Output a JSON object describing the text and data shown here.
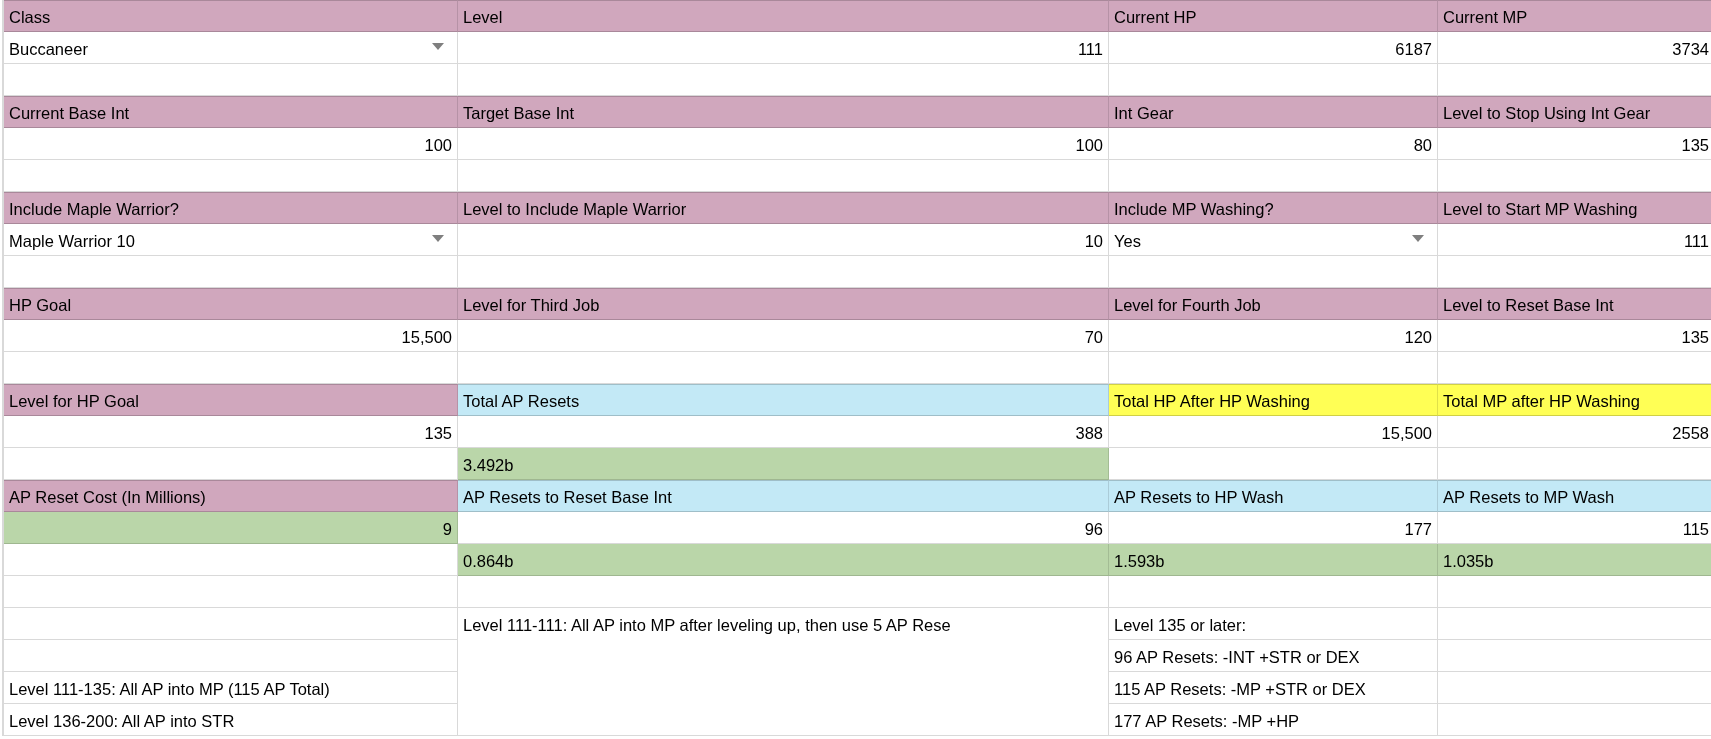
{
  "rows": [
    [
      {
        "kind": "header",
        "text": "Class",
        "color": "#d0a7bd"
      },
      {
        "kind": "header",
        "text": "Level",
        "color": "#d0a7bd"
      },
      {
        "kind": "header",
        "text": "Current HP",
        "color": "#d0a7bd"
      },
      {
        "kind": "header",
        "text": "Current MP",
        "color": "#d0a7bd"
      }
    ],
    [
      {
        "kind": "dropdown",
        "text": "Buccaneer"
      },
      {
        "kind": "number",
        "text": "111"
      },
      {
        "kind": "number",
        "text": "6187"
      },
      {
        "kind": "number",
        "text": "3734"
      }
    ],
    [
      {
        "kind": "blank"
      },
      {
        "kind": "blank"
      },
      {
        "kind": "blank"
      },
      {
        "kind": "blank"
      }
    ],
    [
      {
        "kind": "header",
        "text": "Current Base Int",
        "color": "#d0a7bd"
      },
      {
        "kind": "header",
        "text": "Target Base Int",
        "color": "#d0a7bd"
      },
      {
        "kind": "header",
        "text": "Int Gear",
        "color": "#d0a7bd"
      },
      {
        "kind": "header",
        "text": "Level to Stop Using Int Gear",
        "color": "#d0a7bd"
      }
    ],
    [
      {
        "kind": "number",
        "text": "100"
      },
      {
        "kind": "number",
        "text": "100"
      },
      {
        "kind": "number",
        "text": "80"
      },
      {
        "kind": "number",
        "text": "135"
      }
    ],
    [
      {
        "kind": "blank"
      },
      {
        "kind": "blank"
      },
      {
        "kind": "blank"
      },
      {
        "kind": "blank"
      }
    ],
    [
      {
        "kind": "header",
        "text": "Include Maple Warrior?",
        "color": "#d0a7bd"
      },
      {
        "kind": "header",
        "text": "Level to Include Maple Warrior",
        "color": "#d0a7bd"
      },
      {
        "kind": "header",
        "text": "Include MP Washing?",
        "color": "#d0a7bd"
      },
      {
        "kind": "header",
        "text": "Level to Start MP Washing",
        "color": "#d0a7bd"
      }
    ],
    [
      {
        "kind": "dropdown",
        "text": "Maple Warrior 10"
      },
      {
        "kind": "number",
        "text": "10"
      },
      {
        "kind": "dropdown",
        "text": "Yes"
      },
      {
        "kind": "number",
        "text": "111"
      }
    ],
    [
      {
        "kind": "blank"
      },
      {
        "kind": "blank"
      },
      {
        "kind": "blank"
      },
      {
        "kind": "blank"
      }
    ],
    [
      {
        "kind": "header",
        "text": "HP Goal",
        "color": "#d0a7bd"
      },
      {
        "kind": "header",
        "text": "Level for Third Job",
        "color": "#d0a7bd"
      },
      {
        "kind": "header",
        "text": "Level for Fourth Job",
        "color": "#d0a7bd"
      },
      {
        "kind": "header",
        "text": "Level to Reset Base Int",
        "color": "#d0a7bd"
      }
    ],
    [
      {
        "kind": "number",
        "text": "15,500"
      },
      {
        "kind": "number",
        "text": "70"
      },
      {
        "kind": "number",
        "text": "120"
      },
      {
        "kind": "number",
        "text": "135"
      }
    ],
    [
      {
        "kind": "blank"
      },
      {
        "kind": "blank"
      },
      {
        "kind": "blank"
      },
      {
        "kind": "blank"
      }
    ],
    [
      {
        "kind": "header",
        "text": "Level for HP Goal",
        "color": "#d0a7bd"
      },
      {
        "kind": "header",
        "text": "Total AP Resets",
        "color": "#c3e9f6"
      },
      {
        "kind": "header",
        "text": "Total HP After HP Washing",
        "color": "#ffff55"
      },
      {
        "kind": "header",
        "text": "Total MP after HP Washing",
        "color": "#ffff55"
      }
    ],
    [
      {
        "kind": "number",
        "text": "135"
      },
      {
        "kind": "number",
        "text": "388"
      },
      {
        "kind": "number",
        "text": "15,500"
      },
      {
        "kind": "number",
        "text": "2558"
      }
    ],
    [
      {
        "kind": "blank"
      },
      {
        "kind": "text",
        "text": "3.492b",
        "color": "#bad6a9"
      },
      {
        "kind": "blank"
      },
      {
        "kind": "blank"
      }
    ],
    [
      {
        "kind": "header",
        "text": "AP Reset Cost (In Millions)",
        "color": "#d0a7bd"
      },
      {
        "kind": "header",
        "text": "AP Resets to Reset Base Int",
        "color": "#c3e9f6"
      },
      {
        "kind": "header",
        "text": "AP Resets to HP Wash",
        "color": "#c3e9f6"
      },
      {
        "kind": "header",
        "text": "AP Resets to MP Wash",
        "color": "#c3e9f6"
      }
    ],
    [
      {
        "kind": "number",
        "text": "9",
        "color": "#bad6a9"
      },
      {
        "kind": "number",
        "text": "96"
      },
      {
        "kind": "number",
        "text": "177"
      },
      {
        "kind": "number",
        "text": "115"
      }
    ],
    [
      {
        "kind": "blank"
      },
      {
        "kind": "text",
        "text": "0.864b",
        "color": "#bad6a9"
      },
      {
        "kind": "text",
        "text": "1.593b",
        "color": "#bad6a9"
      },
      {
        "kind": "text",
        "text": "1.035b",
        "color": "#bad6a9"
      }
    ],
    [
      {
        "kind": "blank"
      },
      {
        "kind": "blank"
      },
      {
        "kind": "blank"
      },
      {
        "kind": "blank"
      }
    ],
    [
      {
        "kind": "blank"
      },
      {
        "kind": "note",
        "text": "Level 111-111: All AP into MP after leveling up, then use 5 AP Rese",
        "merged": true
      },
      {
        "kind": "text",
        "text": "Level 135 or later:"
      },
      {
        "kind": "blank"
      }
    ],
    [
      {
        "kind": "blank"
      },
      {
        "kind": "text",
        "text": "96 AP Resets: -INT +STR or DEX"
      },
      {
        "kind": "blank"
      }
    ],
    [
      {
        "kind": "text",
        "text": "Level 111-135: All AP into MP (115 AP Total)"
      },
      {
        "kind": "text",
        "text": "115 AP Resets: -MP +STR or DEX"
      },
      {
        "kind": "blank"
      }
    ],
    [
      {
        "kind": "text",
        "text": "Level 136-200: All AP into STR"
      },
      {
        "kind": "text",
        "text": "177 AP Resets: -MP +HP"
      },
      {
        "kind": "blank"
      }
    ]
  ]
}
